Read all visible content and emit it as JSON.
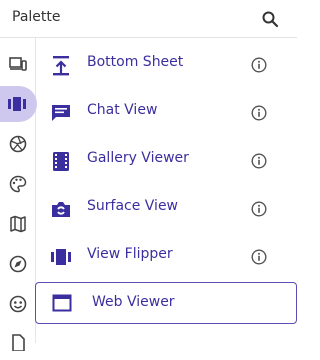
{
  "header": {
    "title": "Palette",
    "search_icon": "search-icon"
  },
  "rail": {
    "items": [
      {
        "name": "devices-icon",
        "active": false
      },
      {
        "name": "view-carousel-icon",
        "active": true
      },
      {
        "name": "camera-shutter-icon",
        "active": false
      },
      {
        "name": "palette-icon",
        "active": false
      },
      {
        "name": "map-icon",
        "active": false
      },
      {
        "name": "compass-icon",
        "active": false
      },
      {
        "name": "face-icon",
        "active": false
      },
      {
        "name": "document-icon",
        "active": false
      }
    ],
    "active_color": "#cfc8ee"
  },
  "components": [
    {
      "label": "Bottom Sheet",
      "icon": "bottom-sheet-icon"
    },
    {
      "label": "Chat View",
      "icon": "chat-icon"
    },
    {
      "label": "Gallery Viewer",
      "icon": "gallery-icon"
    },
    {
      "label": "Surface View",
      "icon": "surface-view-icon"
    },
    {
      "label": "View Flipper",
      "icon": "view-flipper-icon"
    }
  ],
  "selected_component": {
    "label": "Web Viewer",
    "icon": "web-viewer-icon"
  },
  "colors": {
    "accent": "#3b2fa0",
    "border": "#5b4fb4"
  }
}
